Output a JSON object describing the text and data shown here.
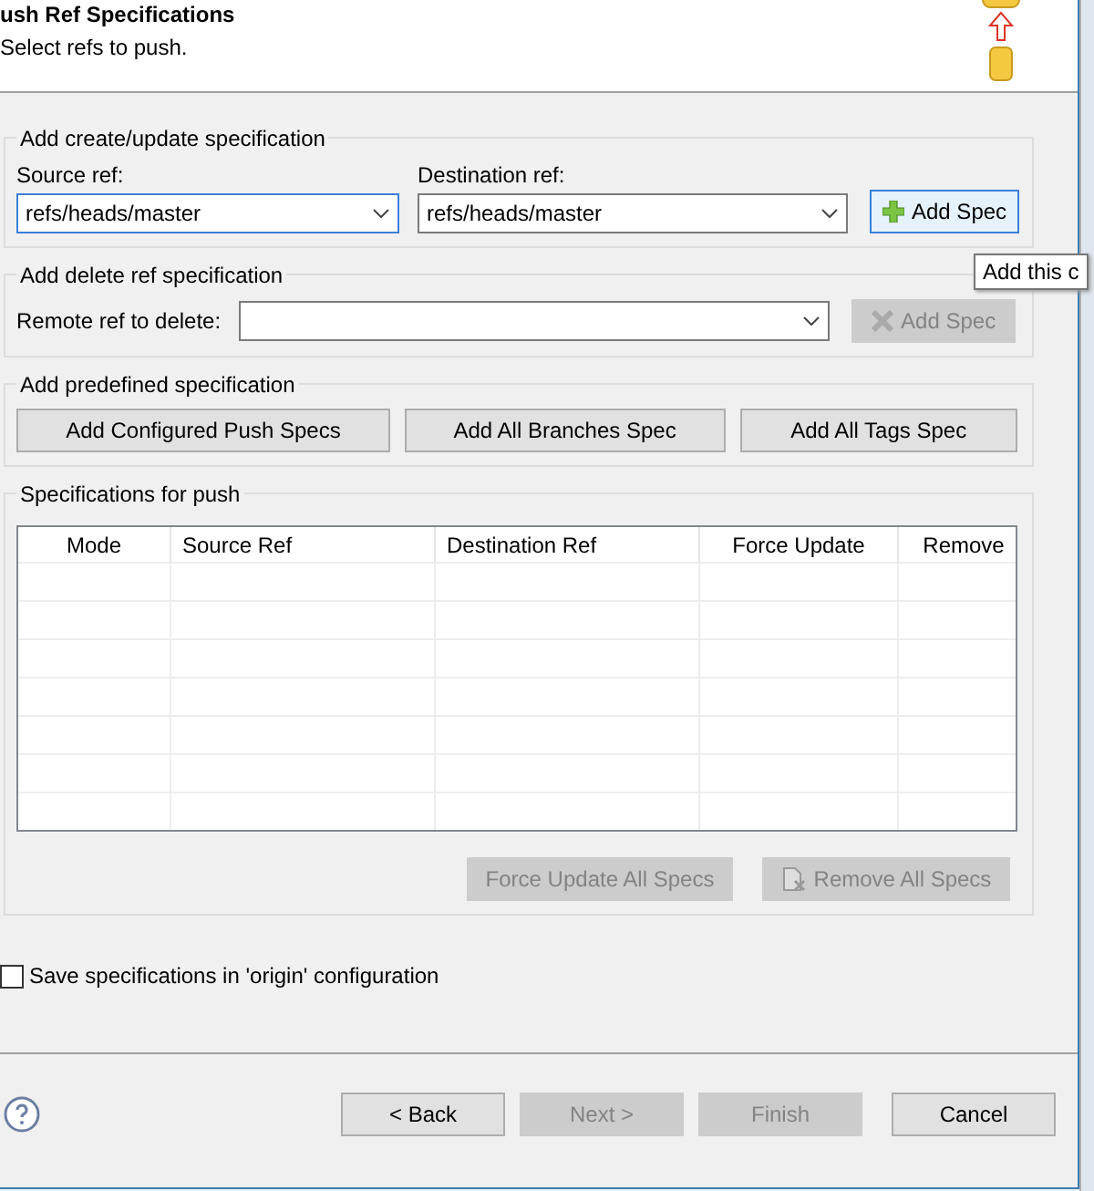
{
  "header": {
    "title": "ush Ref Specifications",
    "subtitle": "Select refs to push."
  },
  "create_group": {
    "title": "Add create/update specification",
    "source": {
      "label": "Source ref:",
      "value": "refs/heads/master",
      "focused": true
    },
    "destination": {
      "label": "Destination ref:",
      "value": "refs/heads/master",
      "focused": false
    },
    "button": {
      "label": "Add Spec",
      "disabled": false,
      "hovered": true
    }
  },
  "tooltip": "Add this c",
  "delete_group": {
    "title": "Add delete ref specification",
    "label": "Remote ref to delete:",
    "button": {
      "label": "Add Spec",
      "disabled": true
    }
  },
  "predefined_group": {
    "title": "Add predefined specification",
    "buttons": [
      "Add Configured Push Specs",
      "Add All Branches Spec",
      "Add All Tags Spec"
    ]
  },
  "specs_group": {
    "title": "Specifications for push",
    "columns": [
      "Mode",
      "Source Ref",
      "Destination Ref",
      "Force Update",
      "Remove"
    ],
    "buttons": [
      {
        "label": "Force Update All Specs",
        "disabled": true,
        "icon": false
      },
      {
        "label": "Remove All Specs",
        "disabled": true,
        "icon": true
      }
    ]
  },
  "save_checkbox": {
    "label": "Save specifications in 'origin' configuration",
    "checked": false
  },
  "footer": {
    "buttons": [
      {
        "label": "< Back",
        "disabled": false
      },
      {
        "label": "Next >",
        "disabled": true
      },
      {
        "label": "Finish",
        "disabled": true
      },
      {
        "label": "Cancel",
        "disabled": false
      }
    ]
  }
}
